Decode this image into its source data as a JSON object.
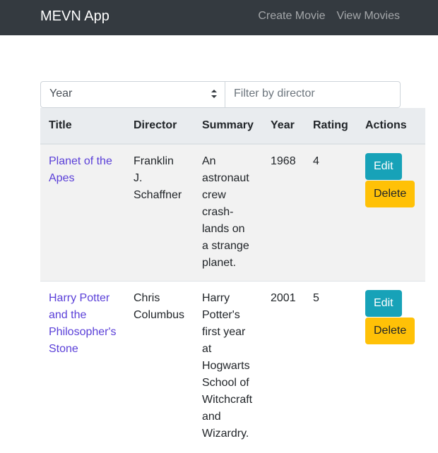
{
  "navbar": {
    "brand": "MEVN App",
    "links": [
      {
        "label": "Create Movie"
      },
      {
        "label": "View Movies"
      }
    ]
  },
  "filters": {
    "select_value": "Year",
    "director_placeholder": "Filter by director"
  },
  "table": {
    "headers": [
      "Title",
      "Director",
      "Summary",
      "Year",
      "Rating",
      "Actions"
    ],
    "rows": [
      {
        "title": "Planet of the Apes",
        "director": "Franklin J. Schaffner",
        "summary": "An astronaut crew crash-lands on a strange planet.",
        "year": "1968",
        "rating": "4",
        "edit_label": "Edit",
        "delete_label": "Delete"
      },
      {
        "title": "Harry Potter and the Philosopher's Stone",
        "director": "Chris Columbus",
        "summary": "Harry Potter's first year at Hogwarts School of Witchcraft and Wizardry.",
        "year": "2001",
        "rating": "5",
        "edit_label": "Edit",
        "delete_label": "Delete"
      }
    ]
  },
  "colors": {
    "navbar": "#343a40",
    "edit_button": "#17a2b8",
    "delete_button": "#ffc107",
    "link": "#5a3fd8"
  }
}
